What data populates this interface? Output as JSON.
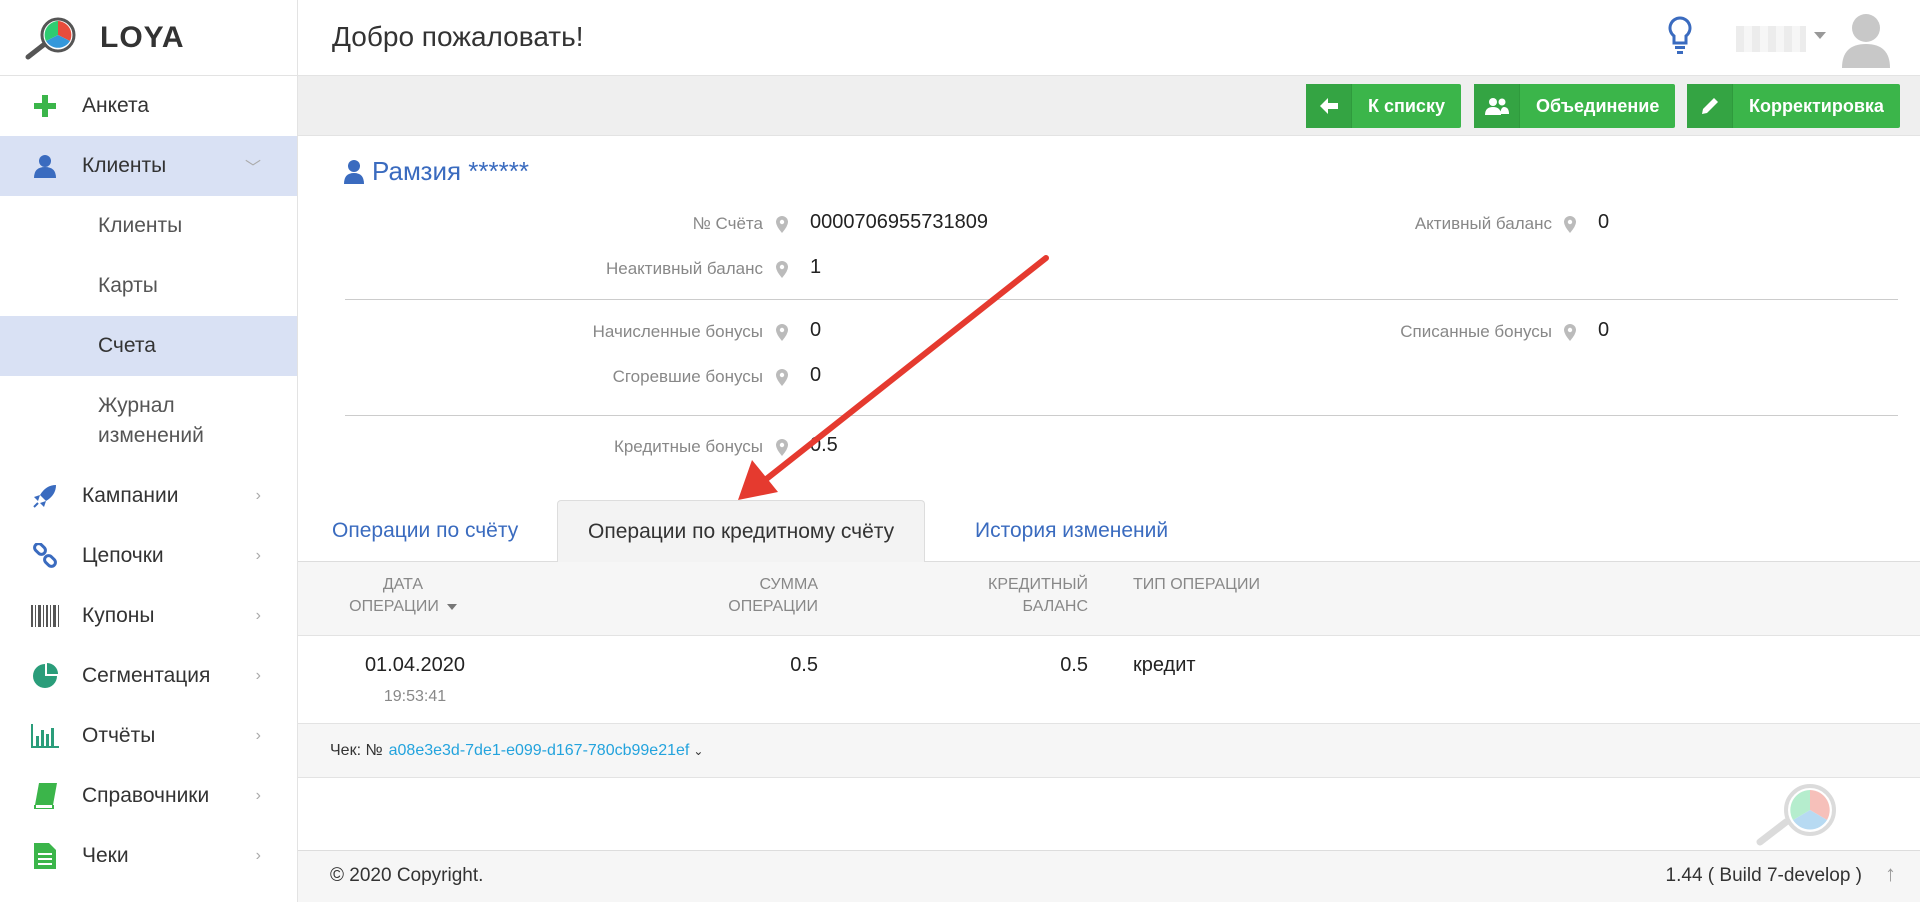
{
  "app": {
    "logo_text": "LOYA"
  },
  "header": {
    "title": "Добро пожаловать!"
  },
  "sidebar": {
    "items": [
      {
        "label": "Анкета",
        "icon": "plus-icon"
      },
      {
        "label": "Клиенты",
        "icon": "user-icon",
        "expanded": true
      },
      {
        "label": "Кампании",
        "icon": "rocket-icon"
      },
      {
        "label": "Цепочки",
        "icon": "chain-icon"
      },
      {
        "label": "Купоны",
        "icon": "barcode-icon"
      },
      {
        "label": "Сегментация",
        "icon": "pie-icon"
      },
      {
        "label": "Отчёты",
        "icon": "bar-chart-icon"
      },
      {
        "label": "Справочники",
        "icon": "book-icon"
      },
      {
        "label": "Чеки",
        "icon": "document-icon"
      }
    ],
    "subitems": [
      {
        "label": "Клиенты"
      },
      {
        "label": "Карты"
      },
      {
        "label": "Счета",
        "active": true
      },
      {
        "label": "Журнал изменений"
      }
    ]
  },
  "toolbar": {
    "back_label": "К списку",
    "merge_label": "Объединение",
    "edit_label": "Корректировка"
  },
  "client": {
    "name": "Рамзия ******",
    "fields": {
      "account_no_label": "№ Счёта",
      "account_no_value": "0000706955731809",
      "active_balance_label": "Активный баланс",
      "active_balance_value": "0",
      "inactive_balance_label": "Неактивный баланс",
      "inactive_balance_value": "1",
      "accrued_label": "Начисленные бонусы",
      "accrued_value": "0",
      "written_off_label": "Списанные бонусы",
      "written_off_value": "0",
      "burned_label": "Сгоревшие бонусы",
      "burned_value": "0",
      "credit_label": "Кредитные бонусы",
      "credit_value": "0.5"
    }
  },
  "tabs": [
    {
      "label": "Операции по счёту"
    },
    {
      "label": "Операции по кредитному счёту",
      "active": true
    },
    {
      "label": "История изменений"
    }
  ],
  "table": {
    "headers": {
      "date_l1": "ДАТА",
      "date_l2": "ОПЕРАЦИИ",
      "sum_l1": "СУММА",
      "sum_l2": "ОПЕРАЦИИ",
      "credit_l1": "КРЕДИТНЫЙ",
      "credit_l2": "БАЛАНС",
      "type": "ТИП ОПЕРАЦИИ"
    },
    "row": {
      "date": "01.04.2020",
      "time": "19:53:41",
      "sum": "0.5",
      "credit": "0.5",
      "type": "кредит"
    },
    "check_prefix": "Чек: №",
    "check_id": "a08e3e3d-7de1-e099-d167-780cb99e21ef"
  },
  "footer": {
    "copyright": "© 2020 Copyright.",
    "build": "1.44 ( Build 7-develop )"
  },
  "colors": {
    "accent": "#3bb54a",
    "link": "#3a6bbf",
    "active_bg": "#d9e1f4",
    "annotation": "#e53a2f"
  }
}
